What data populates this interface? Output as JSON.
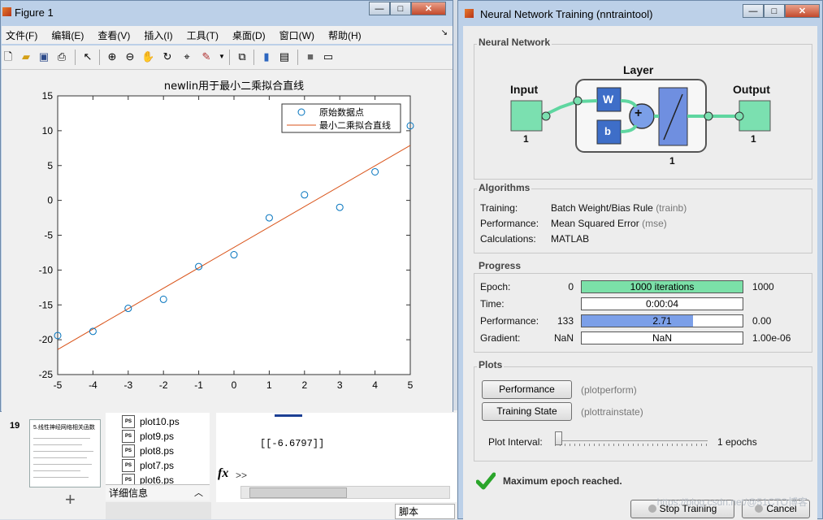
{
  "desktop": {
    "slide_number": "19",
    "slide_title": "5.线性神经网络相关函数",
    "files": [
      "plot10.ps",
      "plot9.ps",
      "plot8.ps",
      "plot7.ps",
      "plot6.ps"
    ],
    "details_label": "详细信息",
    "command_output": "[[-6.6797]]",
    "fx_symbol": "fx",
    "fx_arrows": ">>",
    "script_tab": "脚本",
    "plus": "+"
  },
  "figure": {
    "title": "Figure 1",
    "menus": [
      "文件(F)",
      "编辑(E)",
      "查看(V)",
      "插入(I)",
      "工具(T)",
      "桌面(D)",
      "窗口(W)",
      "帮助(H)"
    ],
    "dock_glyph": "↘",
    "toolbar_icons": [
      "new-file-icon",
      "open-folder-icon",
      "save-icon",
      "print-icon",
      "cursor-icon",
      "zoom-in-icon",
      "zoom-out-icon",
      "pan-hand-icon",
      "rotate-icon",
      "data-cursor-icon",
      "brush-icon",
      "link-icon",
      "colorbar-icon",
      "legend-icon",
      "hide-tools-icon",
      "show-tools-icon"
    ],
    "win_min": "—",
    "win_max": "□",
    "win_close": "✕"
  },
  "chart_data": {
    "type": "scatter",
    "title": "newlin用于最小二乘拟合直线",
    "xlim": [
      -5,
      5
    ],
    "ylim": [
      -25,
      15
    ],
    "xticks": [
      -5,
      -4,
      -3,
      -2,
      -1,
      0,
      1,
      2,
      3,
      4,
      5
    ],
    "yticks": [
      15,
      10,
      5,
      0,
      -5,
      -10,
      -15,
      -20,
      -25
    ],
    "grid": false,
    "legend_position": "top-right",
    "series": [
      {
        "name": "原始数据点",
        "kind": "markers",
        "marker": "circle",
        "color": "#0072bd",
        "x": [
          -5,
          -4,
          -3,
          -2,
          -1,
          0,
          1,
          2,
          3,
          4,
          5
        ],
        "y": [
          -19.4,
          -18.8,
          -15.5,
          -14.2,
          -9.5,
          -7.8,
          -2.5,
          0.8,
          -1.0,
          4.1,
          10.7
        ]
      },
      {
        "name": "最小二乘拟合直线",
        "kind": "line",
        "color": "#d95319",
        "x": [
          -5,
          5
        ],
        "y": [
          -21.4,
          7.9
        ]
      }
    ]
  },
  "nn": {
    "title": "Neural Network Training (nntraintool)",
    "win_min": "—",
    "win_max": "□",
    "win_close": "✕",
    "network": {
      "section": "Neural Network",
      "layer_label": "Layer",
      "input_label": "Input",
      "output_label": "Output",
      "input_size": "1",
      "layer_size": "1",
      "output_size": "1",
      "w_label": "W",
      "b_label": "b",
      "sum_glyph": "+"
    },
    "algorithms": {
      "section": "Algorithms",
      "rows": [
        {
          "label": "Training:",
          "value": "Batch Weight/Bias Rule",
          "code": "(trainb)"
        },
        {
          "label": "Performance:",
          "value": "Mean Squared Error",
          "code": "(mse)"
        },
        {
          "label": "Calculations:",
          "value": "MATLAB",
          "code": ""
        }
      ]
    },
    "progress": {
      "section": "Progress",
      "rows": [
        {
          "label": "Epoch:",
          "start": "0",
          "text": "1000 iterations",
          "end": "1000",
          "fill": 1.0,
          "color": "#7be0a8"
        },
        {
          "label": "Time:",
          "start": "",
          "text": "0:00:04",
          "end": "",
          "fill": 0,
          "color": "#ffffff"
        },
        {
          "label": "Performance:",
          "start": "133",
          "text": "2.71",
          "end": "0.00",
          "fill": 0.69,
          "color": "#7b9fe8"
        },
        {
          "label": "Gradient:",
          "start": "NaN",
          "text": "NaN",
          "end": "1.00e-06",
          "fill": 0,
          "color": "#ffffff"
        }
      ]
    },
    "plots": {
      "section": "Plots",
      "buttons": [
        {
          "label": "Performance",
          "code": "(plotperform)"
        },
        {
          "label": "Training State",
          "code": "(plottrainstate)"
        }
      ],
      "interval_label": "Plot Interval:",
      "interval_value": "1 epochs",
      "interval_fraction": 0.0
    },
    "status": "Maximum epoch reached.",
    "stop_button": "Stop Training",
    "cancel_button": "Cancel",
    "watermark": "https://blog.csdn.net/@51CTO博客"
  }
}
